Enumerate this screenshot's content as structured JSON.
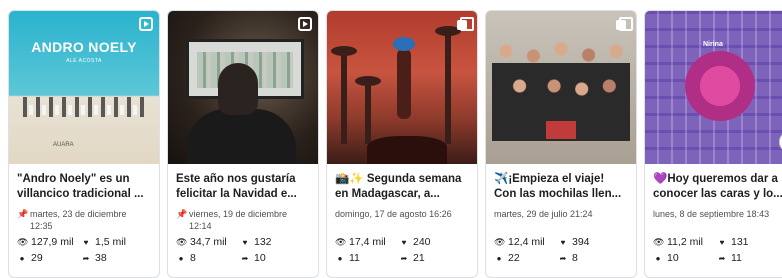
{
  "posts": [
    {
      "type_badge": "reel",
      "thumb": {
        "brand": "ANDRO NOELY",
        "sub": "ALE ACOSTA",
        "footer": "AUARA"
      },
      "title": "\"Andro Noely\" es un villancico tradicional ...",
      "pinned": true,
      "date": "martes, 23 de diciembre 12:35",
      "views": "127,9 mil",
      "likes": "1,5 mil",
      "comments": "29",
      "shares": "38"
    },
    {
      "type_badge": "reel",
      "title": "Este año nos gustaría felicitar la Navidad e...",
      "pinned": true,
      "date": "viernes, 19 de diciembre 12:14",
      "views": "34,7 mil",
      "likes": "132",
      "comments": "8",
      "shares": "10"
    },
    {
      "type_badge": "album",
      "title": "📸✨ Segunda semana en Madagascar, a...",
      "pinned": false,
      "date": "domingo, 17 de agosto 16:26",
      "views": "17,4 mil",
      "likes": "240",
      "comments": "11",
      "shares": "21"
    },
    {
      "type_badge": "album",
      "title": "✈️¡Empieza el viaje! Con las mochilas llen...",
      "pinned": false,
      "date": "martes, 29 de julio 21:24",
      "views": "12,4 mil",
      "likes": "394",
      "comments": "22",
      "shares": "8"
    },
    {
      "type_badge": "none",
      "thumb": {
        "brand": "Nirina"
      },
      "title": "💜Hoy queremos dar a conocer las caras y lo...",
      "pinned": false,
      "date": "lunes, 8 de septiembre 18:43",
      "views": "11,2 mil",
      "likes": "131",
      "comments": "10",
      "shares": "11"
    }
  ],
  "icons": {
    "pin": "pin-icon",
    "views": "eye-icon",
    "likes": "heart-icon",
    "comments": "comment-bubble-icon",
    "shares": "share-arrow-icon"
  }
}
